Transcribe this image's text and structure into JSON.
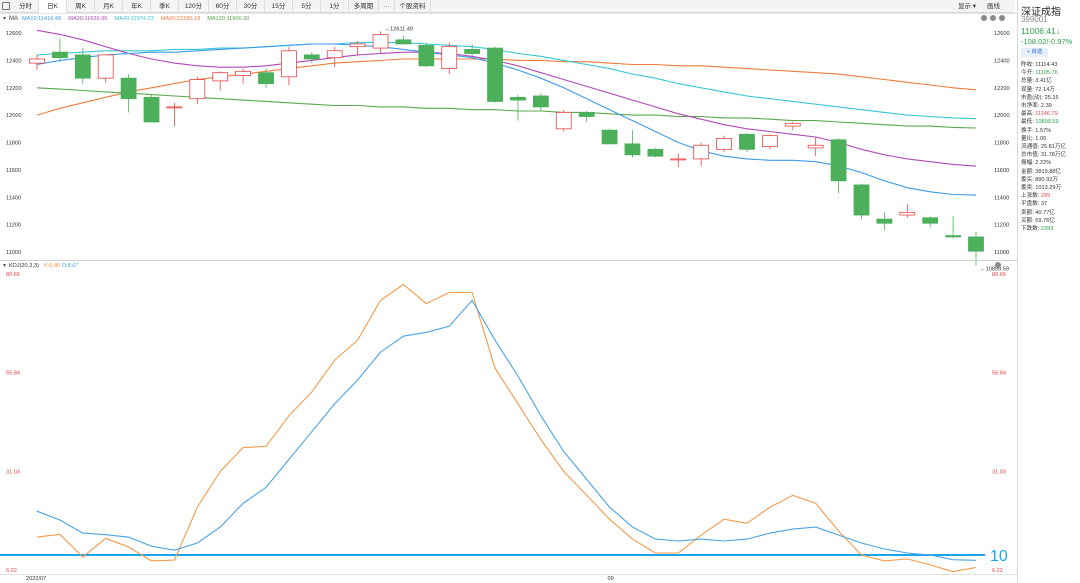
{
  "toolbar": {
    "tabs": [
      {
        "label": "分时",
        "active": false
      },
      {
        "label": "日K",
        "active": true
      },
      {
        "label": "周K",
        "active": false
      },
      {
        "label": "月K",
        "active": false
      },
      {
        "label": "年K",
        "active": false
      },
      {
        "label": "季K",
        "active": false
      },
      {
        "label": "120分",
        "active": false
      },
      {
        "label": "60分",
        "active": false
      },
      {
        "label": "30分",
        "active": false
      },
      {
        "label": "15分",
        "active": false
      },
      {
        "label": "5分",
        "active": false
      },
      {
        "label": "1分",
        "active": false
      },
      {
        "label": "多周期",
        "active": false
      },
      {
        "label": "···",
        "active": false
      },
      {
        "label": "个股资料",
        "active": false
      }
    ],
    "display_label": "显示",
    "draw_label": "画线"
  },
  "stock": {
    "name": "深证成指",
    "code": "399001",
    "price": "11006.41",
    "arrow": "↓",
    "change": "-108.02/-0.97%",
    "watch_label": "+ 自选"
  },
  "stats": [
    {
      "label": "昨收:",
      "value": "11114.43",
      "tone": "neutral"
    },
    {
      "label": "今开:",
      "value": "11105.76",
      "tone": "down"
    },
    {
      "label": "总量:",
      "value": "3.41亿",
      "tone": "neutral"
    },
    {
      "label": "现量:",
      "value": "72.14万",
      "tone": "neutral"
    },
    {
      "label": "市盈(动):",
      "value": "25.16",
      "tone": "neutral"
    },
    {
      "label": "市净率:",
      "value": "2.39",
      "tone": "neutral"
    },
    {
      "label": "最高:",
      "value": "11146.79",
      "tone": "up"
    },
    {
      "label": "最低:",
      "value": "10899.59",
      "tone": "down"
    },
    {
      "label": "换手:",
      "value": "1.57%",
      "tone": "neutral"
    },
    {
      "label": "量比:",
      "value": "1.00",
      "tone": "neutral"
    },
    {
      "label": "流通值:",
      "value": "25.81万亿",
      "tone": "neutral"
    },
    {
      "label": "总市值:",
      "value": "31.78万亿",
      "tone": "neutral"
    },
    {
      "label": "振幅:",
      "value": "2.22%",
      "tone": "neutral"
    },
    {
      "label": "金额:",
      "value": "3819.88亿",
      "tone": "neutral"
    },
    {
      "label": "委买:",
      "value": "890.92万",
      "tone": "neutral"
    },
    {
      "label": "委卖:",
      "value": "1013.29万",
      "tone": "neutral"
    },
    {
      "label": "上涨数:",
      "value": "299",
      "tone": "up"
    },
    {
      "label": "平盘数:",
      "value": "37",
      "tone": "neutral"
    },
    {
      "label": "卖额:",
      "value": "40.77亿",
      "tone": "neutral"
    },
    {
      "label": "买额:",
      "value": "59.76亿",
      "tone": "neutral"
    },
    {
      "label": "下跌数:",
      "value": "2393",
      "tone": "down"
    }
  ],
  "colors": {
    "up": "#e54545",
    "down": "#2aa24a",
    "candle_down_fill": "#4caf5a",
    "ma10": "#3d9be9",
    "ma20": "#b04ab8",
    "ma40": "#39c6d4",
    "ma60": "#f07c3c",
    "ma120": "#5aa850",
    "k": "#f39a4a",
    "d": "#4aa3e6",
    "ref": "#1aa6e8"
  },
  "chart_data": [
    {
      "type": "candlestick",
      "title": "MA",
      "legend": [
        {
          "name": "MA10",
          "value": "11416.48",
          "key": "ma10"
        },
        {
          "name": "MA20",
          "value": "11626.95",
          "key": "ma20"
        },
        {
          "name": "MA40",
          "value": "11974.23",
          "key": "ma40"
        },
        {
          "name": "MA60",
          "value": "12185.18",
          "key": "ma60"
        },
        {
          "name": "MA120",
          "value": "11906.30",
          "key": "ma120"
        }
      ],
      "ylim": [
        10840,
        12680
      ],
      "yticks": [
        11000,
        11200,
        11400,
        11600,
        11800,
        12000,
        12200,
        12400,
        12600
      ],
      "x_start_label": "2022/07",
      "x_mid_label": "09",
      "x_mid_index": 25,
      "candles": [
        {
          "o": 12380,
          "h": 12440,
          "l": 12330,
          "c": 12410
        },
        {
          "o": 12460,
          "h": 12560,
          "l": 12390,
          "c": 12420
        },
        {
          "o": 12440,
          "h": 12490,
          "l": 12230,
          "c": 12270
        },
        {
          "o": 12270,
          "h": 12420,
          "l": 12240,
          "c": 12440
        },
        {
          "o": 12270,
          "h": 12300,
          "l": 12020,
          "c": 12120
        },
        {
          "o": 12130,
          "h": 12150,
          "l": 11950,
          "c": 11950
        },
        {
          "o": 12060,
          "h": 12090,
          "l": 11920,
          "c": 12060
        },
        {
          "o": 12120,
          "h": 12280,
          "l": 12080,
          "c": 12260
        },
        {
          "o": 12250,
          "h": 12320,
          "l": 12180,
          "c": 12310
        },
        {
          "o": 12290,
          "h": 12340,
          "l": 12230,
          "c": 12320
        },
        {
          "o": 12310,
          "h": 12340,
          "l": 12200,
          "c": 12230
        },
        {
          "o": 12280,
          "h": 12500,
          "l": 12220,
          "c": 12470
        },
        {
          "o": 12440,
          "h": 12460,
          "l": 12380,
          "c": 12410
        },
        {
          "o": 12420,
          "h": 12500,
          "l": 12350,
          "c": 12470
        },
        {
          "o": 12500,
          "h": 12540,
          "l": 12440,
          "c": 12520
        },
        {
          "o": 12490,
          "h": 12612,
          "l": 12450,
          "c": 12590
        },
        {
          "o": 12550,
          "h": 12580,
          "l": 12520,
          "c": 12520
        },
        {
          "o": 12510,
          "h": 12530,
          "l": 12350,
          "c": 12360
        },
        {
          "o": 12340,
          "h": 12530,
          "l": 12300,
          "c": 12500
        },
        {
          "o": 12480,
          "h": 12520,
          "l": 12430,
          "c": 12450
        },
        {
          "o": 12490,
          "h": 12500,
          "l": 12090,
          "c": 12100
        },
        {
          "o": 12130,
          "h": 12150,
          "l": 11960,
          "c": 12110
        },
        {
          "o": 12140,
          "h": 12160,
          "l": 12030,
          "c": 12060
        },
        {
          "o": 11900,
          "h": 12040,
          "l": 11880,
          "c": 12020
        },
        {
          "o": 12020,
          "h": 12030,
          "l": 11950,
          "c": 11990
        },
        {
          "o": 11890,
          "h": 11900,
          "l": 11790,
          "c": 11790
        },
        {
          "o": 11790,
          "h": 11890,
          "l": 11690,
          "c": 11710
        },
        {
          "o": 11750,
          "h": 11760,
          "l": 11690,
          "c": 11700
        },
        {
          "o": 11680,
          "h": 11720,
          "l": 11620,
          "c": 11680
        },
        {
          "o": 11680,
          "h": 11800,
          "l": 11630,
          "c": 11780
        },
        {
          "o": 11750,
          "h": 11850,
          "l": 11730,
          "c": 11830
        },
        {
          "o": 11860,
          "h": 11870,
          "l": 11730,
          "c": 11750
        },
        {
          "o": 11770,
          "h": 11860,
          "l": 11750,
          "c": 11850
        },
        {
          "o": 11920,
          "h": 11950,
          "l": 11890,
          "c": 11940
        },
        {
          "o": 11760,
          "h": 11840,
          "l": 11700,
          "c": 11780
        },
        {
          "o": 11820,
          "h": 11830,
          "l": 11430,
          "c": 11520
        },
        {
          "o": 11490,
          "h": 11500,
          "l": 11240,
          "c": 11270
        },
        {
          "o": 11240,
          "h": 11290,
          "l": 11160,
          "c": 11210
        },
        {
          "o": 11270,
          "h": 11350,
          "l": 11250,
          "c": 11290
        },
        {
          "o": 11250,
          "h": 11260,
          "l": 11180,
          "c": 11210
        },
        {
          "o": 11120,
          "h": 11260,
          "l": 11100,
          "c": 11110
        },
        {
          "o": 11110,
          "h": 11147,
          "l": 10900,
          "c": 11006
        }
      ],
      "ma": {
        "ma10": [
          12370,
          12400,
          12420,
          12440,
          12450,
          12460,
          12460,
          12470,
          12480,
          12490,
          12500,
          12510,
          12520,
          12520,
          12510,
          12500,
          12480,
          12460,
          12440,
          12420,
          12380,
          12330,
          12270,
          12200,
          12120,
          12040,
          11960,
          11880,
          11800,
          11740,
          11700,
          11680,
          11670,
          11670,
          11660,
          11630,
          11580,
          11520,
          11470,
          11440,
          11420,
          11416
        ],
        "ma20": [
          12620,
          12590,
          12550,
          12500,
          12450,
          12410,
          12380,
          12360,
          12350,
          12350,
          12360,
          12380,
          12400,
          12420,
          12440,
          12450,
          12460,
          12460,
          12450,
          12430,
          12400,
          12360,
          12310,
          12260,
          12210,
          12160,
          12110,
          12060,
          12010,
          11970,
          11930,
          11900,
          11880,
          11860,
          11840,
          11800,
          11750,
          11710,
          11680,
          11660,
          11640,
          11627
        ],
        "ma40": [
          12440,
          12450,
          12460,
          12470,
          12470,
          12470,
          12480,
          12480,
          12490,
          12490,
          12500,
          12510,
          12520,
          12520,
          12530,
          12530,
          12530,
          12520,
          12510,
          12500,
          12480,
          12450,
          12430,
          12400,
          12370,
          12340,
          12300,
          12270,
          12230,
          12200,
          12170,
          12140,
          12120,
          12100,
          12080,
          12060,
          12040,
          12020,
          12000,
          11990,
          11980,
          11974
        ],
        "ma60": [
          12000,
          12050,
          12090,
          12130,
          12170,
          12200,
          12230,
          12260,
          12280,
          12300,
          12320,
          12340,
          12360,
          12380,
          12390,
          12400,
          12410,
          12410,
          12410,
          12410,
          12410,
          12400,
          12400,
          12390,
          12390,
          12380,
          12370,
          12370,
          12360,
          12360,
          12350,
          12340,
          12330,
          12320,
          12310,
          12300,
          12280,
          12260,
          12240,
          12220,
          12200,
          12185
        ],
        "ma120": [
          12200,
          12190,
          12180,
          12170,
          12160,
          12150,
          12140,
          12130,
          12120,
          12110,
          12100,
          12090,
          12080,
          12070,
          12070,
          12060,
          12060,
          12050,
          12050,
          12040,
          12040,
          12030,
          12030,
          12020,
          12020,
          12010,
          12000,
          12000,
          11990,
          11990,
          11980,
          11980,
          11970,
          11960,
          11960,
          11950,
          11940,
          11930,
          11920,
          11920,
          11910,
          11906
        ]
      },
      "annotations": [
        {
          "text": "12611.49",
          "index": 15,
          "value": 12611.49
        },
        {
          "text": "10899.59",
          "index": 41,
          "value": 10899.59
        }
      ]
    },
    {
      "type": "line",
      "title": "KDJ(20,3,3)",
      "legend": [
        {
          "name": "K",
          "value": "6.86",
          "key": "k"
        },
        {
          "name": "D",
          "value": "8.67",
          "key": "d"
        }
      ],
      "ylim": [
        6.22,
        80.65
      ],
      "yticks": [
        6.22,
        31.03,
        55.84,
        80.65
      ],
      "reference_line": {
        "value": 10,
        "label": "10"
      },
      "series": [
        {
          "name": "K",
          "key": "k",
          "values": [
            14.5,
            15.2,
            9.5,
            14.2,
            12.0,
            8.5,
            8.7,
            22,
            31,
            37,
            37.3,
            45,
            51,
            59,
            64,
            74,
            78,
            73.2,
            76,
            76,
            57,
            48,
            39,
            31,
            25,
            19,
            14,
            10.5,
            10.5,
            15,
            19,
            18,
            22,
            25,
            23,
            16,
            10,
            8.5,
            9,
            7.5,
            5.8,
            6.86
          ]
        },
        {
          "name": "D",
          "key": "d",
          "values": [
            21,
            18.8,
            15.5,
            15.1,
            14.5,
            12.2,
            11.2,
            13,
            17,
            23,
            27,
            34,
            41,
            48,
            54,
            61,
            65,
            66,
            67.5,
            74,
            64,
            55,
            45,
            36,
            29,
            22,
            17,
            14,
            13.5,
            14,
            13.5,
            14,
            15.5,
            16.5,
            17,
            15,
            13,
            11.5,
            10.5,
            10,
            8.8,
            8.67
          ]
        }
      ]
    }
  ]
}
